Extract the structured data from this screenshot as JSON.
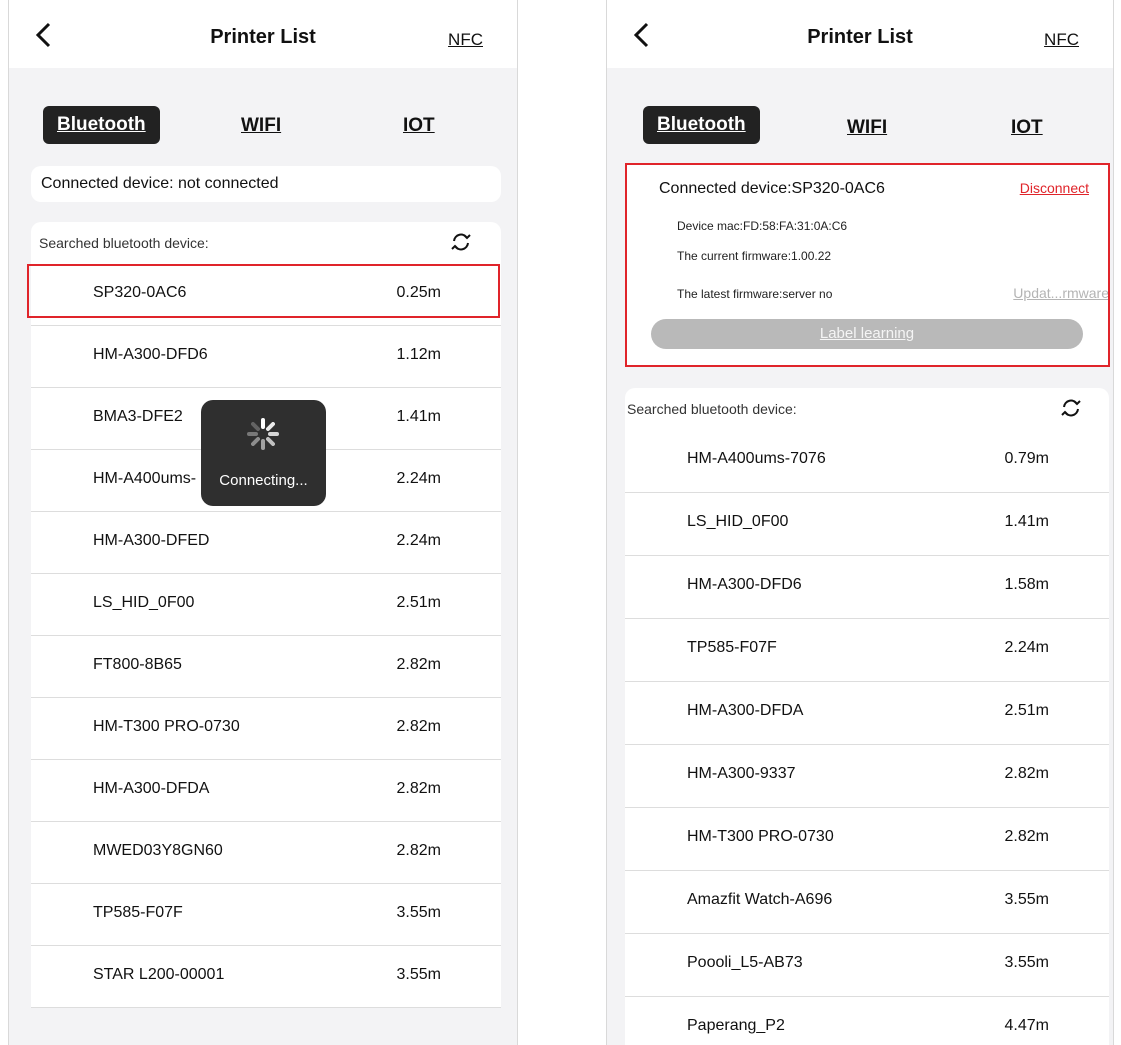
{
  "left": {
    "header": {
      "title": "Printer List",
      "nfc": "NFC"
    },
    "tabs": [
      "Bluetooth",
      "WIFI",
      "IOT"
    ],
    "connected_text": "Connected device: not connected",
    "search_label": "Searched bluetooth device:",
    "overlay": {
      "text": "Connecting..."
    },
    "devices": [
      {
        "name": "SP320-0AC6",
        "dist": "0.25m"
      },
      {
        "name": "HM-A300-DFD6",
        "dist": "1.12m"
      },
      {
        "name": "BMA3-DFE2",
        "dist": "1.41m"
      },
      {
        "name": "HM-A400ums-",
        "dist": "2.24m"
      },
      {
        "name": "HM-A300-DFED",
        "dist": "2.24m"
      },
      {
        "name": "LS_HID_0F00",
        "dist": "2.51m"
      },
      {
        "name": "FT800-8B65",
        "dist": "2.82m"
      },
      {
        "name": "HM-T300 PRO-0730",
        "dist": "2.82m"
      },
      {
        "name": "HM-A300-DFDA",
        "dist": "2.82m"
      },
      {
        "name": "MWED03Y8GN60",
        "dist": "2.82m"
      },
      {
        "name": "TP585-F07F",
        "dist": "3.55m"
      },
      {
        "name": "STAR L200-00001",
        "dist": "3.55m"
      }
    ]
  },
  "right": {
    "header": {
      "title": "Printer List",
      "nfc": "NFC"
    },
    "tabs": [
      "Bluetooth",
      "WIFI",
      "IOT"
    ],
    "connected_text": "Connected device:SP320-0AC6",
    "disconnect": "Disconnect",
    "mac": "Device mac:FD:58:FA:31:0A:C6",
    "firmware": "The current firmware:1.00.22",
    "latest": "The latest firmware:server no",
    "update": "Updat...rmware",
    "label_learning": "Label learning",
    "search_label": "Searched bluetooth device:",
    "devices": [
      {
        "name": "HM-A400ums-7076",
        "dist": "0.79m"
      },
      {
        "name": "LS_HID_0F00",
        "dist": "1.41m"
      },
      {
        "name": "HM-A300-DFD6",
        "dist": "1.58m"
      },
      {
        "name": "TP585-F07F",
        "dist": "2.24m"
      },
      {
        "name": "HM-A300-DFDA",
        "dist": "2.51m"
      },
      {
        "name": "HM-A300-9337",
        "dist": "2.82m"
      },
      {
        "name": "HM-T300 PRO-0730",
        "dist": "2.82m"
      },
      {
        "name": "Amazfit Watch-A696",
        "dist": "3.55m"
      },
      {
        "name": "Poooli_L5-AB73",
        "dist": "3.55m"
      },
      {
        "name": "Paperang_P2",
        "dist": "4.47m"
      }
    ]
  },
  "colors": {
    "highlight": "#e0242a",
    "active_tab": "#222222",
    "spinner_bg": "#2f2f2f"
  },
  "icons": [
    "back-arrow-icon",
    "refresh-icon",
    "loading-spinner-icon"
  ]
}
